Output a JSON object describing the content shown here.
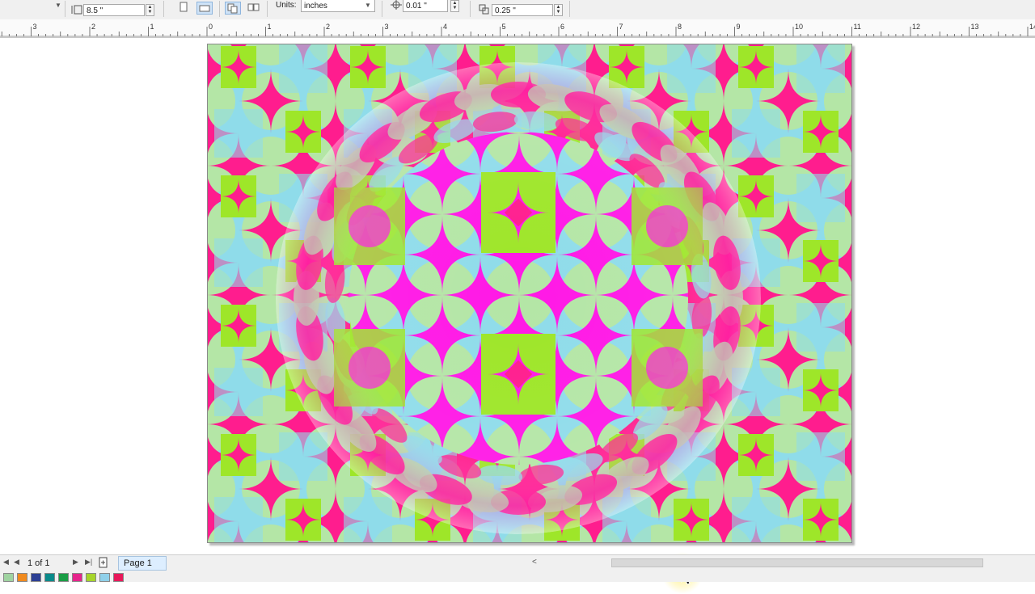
{
  "property_bar": {
    "height_value": "8.5 \"",
    "units_label": "Units:",
    "units_value": "inches",
    "nudge_value": "0.01 \"",
    "duplicate_distance_value": "0.25 \""
  },
  "ruler": {
    "labels": [
      "3",
      "2",
      "1",
      "0",
      "1",
      "2",
      "3",
      "4",
      "5",
      "6",
      "7",
      "8",
      "9",
      "10",
      "11",
      "12",
      "13",
      "14"
    ]
  },
  "navigator": {
    "page_count": "1 of 1",
    "page_tab": "Page 1"
  },
  "palette": {
    "colors": [
      "#9fd3a0",
      "#f08a1e",
      "#2c3f94",
      "#0a8a8a",
      "#1a9d45",
      "#e6248c",
      "#a6d42a",
      "#8fd0ea",
      "#e8185a"
    ]
  },
  "pattern_colors": {
    "pink": "#ff1d8e",
    "light_blue": "#8fdcea",
    "mint": "#b4e6a6",
    "lime": "#9ee629",
    "magenta": "#ff18e6"
  }
}
